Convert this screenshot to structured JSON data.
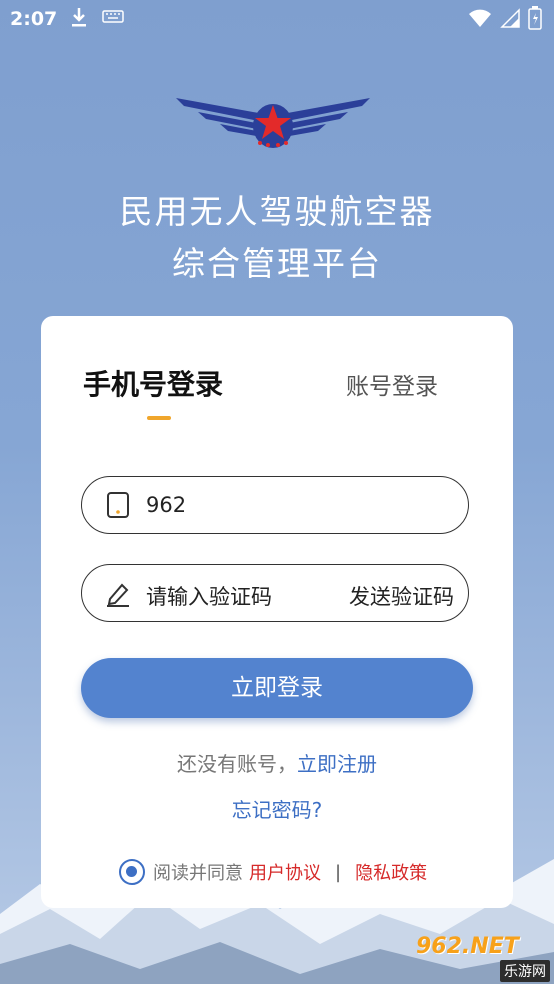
{
  "status_bar": {
    "time": "2:07",
    "icons": [
      "download-icon",
      "keyboard-icon",
      "wifi-icon",
      "signal-icon",
      "battery-icon"
    ]
  },
  "header": {
    "title_line1": "民用无人驾驶航空器",
    "title_line2": "综合管理平台"
  },
  "login": {
    "tab_phone": "手机号登录",
    "tab_account": "账号登录",
    "phone_value": "962",
    "code_placeholder": "请输入验证码",
    "send_code": "发送验证码",
    "login_button": "立即登录",
    "no_account_text": "还没有账号，",
    "register_link": "立即注册",
    "forgot_password": "忘记密码?",
    "agree_text": "阅读并同意",
    "user_agreement": "用户协议",
    "separator": "|",
    "privacy_policy": "隐私政策"
  },
  "watermark": {
    "top": "962.NET",
    "bottom": "乐游网"
  },
  "colors": {
    "background": "#86a6d4",
    "primary": "#5383cf",
    "link": "#3d6fc4",
    "accent_underline": "#f0a62c",
    "policy_red": "#d62a2a"
  }
}
